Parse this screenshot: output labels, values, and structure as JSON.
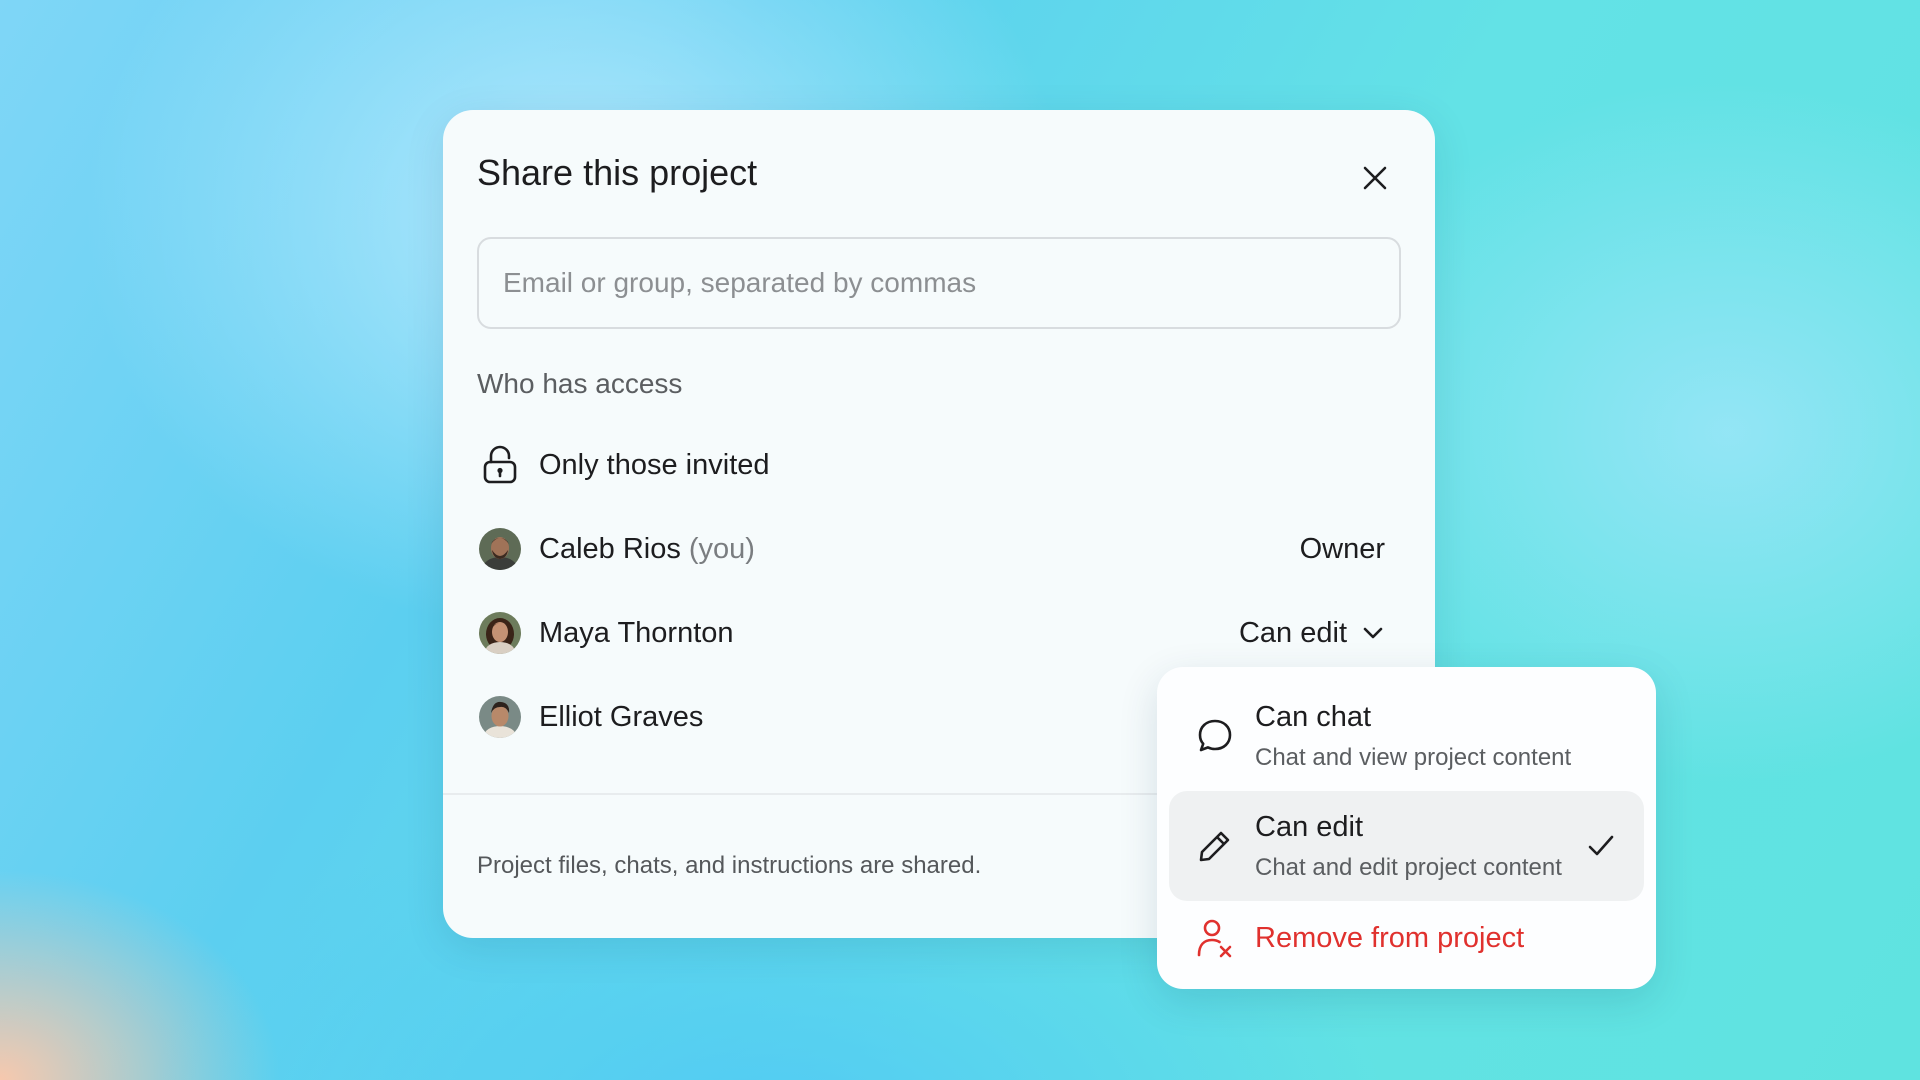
{
  "dialog": {
    "title": "Share this project",
    "search": {
      "placeholder": "Email or group, separated by commas",
      "value": ""
    },
    "section_label": "Who has access",
    "access_setting": {
      "label": "Only those invited",
      "icon": "lock-icon"
    },
    "members": [
      {
        "name": "Caleb Rios",
        "suffix": "(you)",
        "role": "Owner"
      },
      {
        "name": "Maya Thornton",
        "role": "Can edit"
      },
      {
        "name": "Elliot Graves",
        "role": ""
      }
    ],
    "footer_note": "Project files, chats, and instructions are shared."
  },
  "role_menu": {
    "options": [
      {
        "title": "Can chat",
        "description": "Chat and view project content",
        "icon": "chat-bubble-icon",
        "selected": false
      },
      {
        "title": "Can edit",
        "description": "Chat and edit project content",
        "icon": "pencil-icon",
        "selected": true
      }
    ],
    "remove_label": "Remove from project",
    "remove_icon": "remove-user-icon"
  },
  "colors": {
    "danger": "#e0312e",
    "selected_bg": "#eff1f2",
    "text": "#1d1d1f"
  }
}
